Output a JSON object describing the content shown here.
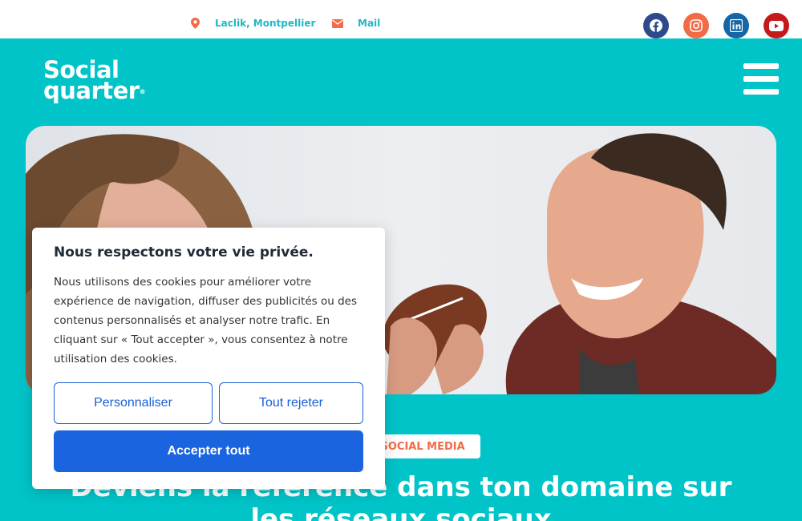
{
  "topbar": {
    "location": "Laclik, Montpellier",
    "mail": "Mail",
    "social": [
      {
        "name": "facebook-icon",
        "color": "#2d4a8a"
      },
      {
        "name": "instagram-icon",
        "color": "#f26b46"
      },
      {
        "name": "linkedin-icon",
        "color": "#1666a5"
      },
      {
        "name": "youtube-icon",
        "color": "#c41a1a"
      }
    ]
  },
  "header": {
    "logo_line1": "Social",
    "logo_line2": "quarter",
    "logo_reg": "®"
  },
  "hero": {
    "tag": "G SOCIAL MEDIA",
    "headline": "Deviens la référence dans ton domaine sur les réseaux sociaux"
  },
  "cookie": {
    "title": "Nous respectons votre vie privée.",
    "body": "Nous utilisons des cookies pour améliorer votre expérience de navigation, diffuser des publicités ou des contenus personnalisés et analyser notre trafic. En cliquant sur « Tout accepter », vous consentez à notre utilisation des cookies.",
    "customize_label": "Personnaliser",
    "reject_label": "Tout rejeter",
    "accept_label": "Accepter tout"
  },
  "colors": {
    "brand_teal": "#00c4c8",
    "accent_orange": "#f26b46",
    "primary_blue": "#1a64e0"
  }
}
